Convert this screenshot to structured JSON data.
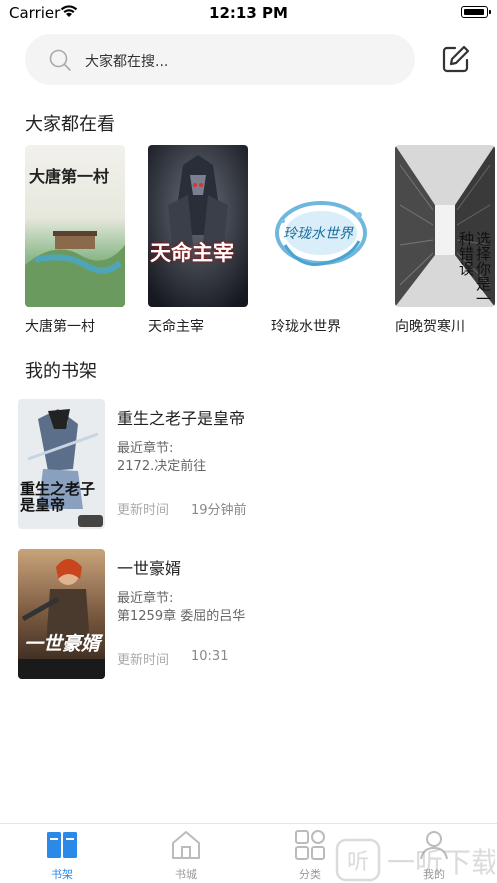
{
  "status_bar": {
    "carrier": "Carrier",
    "time": "12:13 PM"
  },
  "search": {
    "placeholder": "大家都在搜..."
  },
  "hot_section": {
    "title": "大家都在看",
    "books": [
      {
        "name": "大唐第一村",
        "cover_text": "大唐第一村"
      },
      {
        "name": "天命主宰",
        "cover_text": "天命主宰"
      },
      {
        "name": "玲珑水世界",
        "cover_text": "玲珑水世界"
      },
      {
        "name": "向晚贺寒川",
        "cover_text": "选择你是一种错误"
      }
    ]
  },
  "shelf_section": {
    "title": "我的书架",
    "books": [
      {
        "title": "重生之老子是皇帝",
        "chapter_label": "最近章节:",
        "chapter_name": "2172.决定前往",
        "update_label": "更新时间",
        "update_time": "19分钟前",
        "cover_text": "重生之老子是皇帝"
      },
      {
        "title": "一世豪婿",
        "chapter_label": "最近章节:",
        "chapter_name": "第1259章 委屈的吕华",
        "update_label": "更新时间",
        "update_time": "10:31",
        "cover_text": "一世豪婿"
      }
    ]
  },
  "tab_bar": {
    "tabs": [
      {
        "label": "书架",
        "icon": "bookshelf-icon",
        "active": true
      },
      {
        "label": "书城",
        "icon": "house-icon",
        "active": false
      },
      {
        "label": "分类",
        "icon": "grid-icon",
        "active": false
      },
      {
        "label": "我的",
        "icon": "user-icon",
        "active": false
      }
    ]
  },
  "colors": {
    "accent": "#2b8ae8",
    "search_bg": "#f4f4f4",
    "text": "#222222",
    "muted": "#999999"
  }
}
